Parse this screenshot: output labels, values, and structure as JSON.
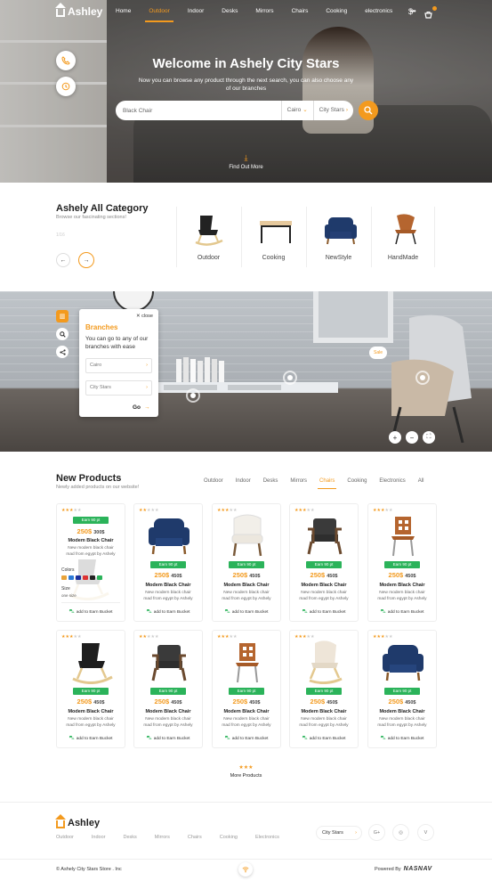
{
  "header": {
    "brand": "Ashley",
    "nav": [
      {
        "label": "Home",
        "active": false
      },
      {
        "label": "Outdoor",
        "active": true
      },
      {
        "label": "Indoor",
        "active": false
      },
      {
        "label": "Desks",
        "active": false
      },
      {
        "label": "Mirrors",
        "active": false
      },
      {
        "label": "Chairs",
        "active": false
      },
      {
        "label": "Cooking",
        "active": false
      },
      {
        "label": "electronics",
        "active": false
      }
    ],
    "more": "•••",
    "currency_icon": "$",
    "cart_icon": "cart"
  },
  "hero": {
    "title": "Welcome in Ashely City Stars",
    "subtitle": "Now you can browse any product through the next search, you can also choose any of our branches",
    "search_value": "Black Chair",
    "city": "Cairo",
    "branch": "City Stars",
    "find_more": "Find Out More"
  },
  "category": {
    "title": "Ashely All Category",
    "subtitle": "Browse our fascinating sections!",
    "count": "1/16",
    "items": [
      "Outdoor",
      "Cooking",
      "NewStyle",
      "HandMade"
    ]
  },
  "branches": {
    "close": "close",
    "title": "Branches",
    "desc": "You can go to any of our branches with ease",
    "city": "Cairo",
    "branch": "City Stars",
    "go": "Go"
  },
  "room": {
    "sale": "Sale"
  },
  "products": {
    "title": "New Products",
    "subtitle": "Newly added products on our website!",
    "filters": [
      {
        "label": "Outdoor",
        "active": false
      },
      {
        "label": "Indoor",
        "active": false
      },
      {
        "label": "Desks",
        "active": false
      },
      {
        "label": "Mirrors",
        "active": false
      },
      {
        "label": "Chairs",
        "active": true
      },
      {
        "label": "Cooking",
        "active": false
      },
      {
        "label": "Electronics",
        "active": false
      },
      {
        "label": "All",
        "active": false
      }
    ],
    "colors_label": "Colors",
    "size_label": "Size",
    "size_value": "one size",
    "swatches": [
      "#e8a33a",
      "#2c7ad6",
      "#1a2f9c",
      "#d33",
      "#222",
      "#2bb35a"
    ],
    "items": [
      {
        "earn": "Earn 90 pt",
        "price": "250$",
        "old": "300$",
        "name": "Modem Black Chair",
        "desc": "New modern black chair mad from egypt by Ashely",
        "add": "add to Earn Bucket",
        "rating": 3,
        "img": "rocking",
        "expanded": true
      },
      {
        "earn": "Earn 90 pt",
        "price": "250$",
        "old": "450$",
        "name": "Modem Black Chair",
        "desc": "New modern black chair mad from egypt by Ashely",
        "add": "add to Earn Bucket",
        "rating": 2,
        "img": "navy"
      },
      {
        "earn": "Earn 90 pt",
        "price": "250$",
        "old": "450$",
        "name": "Modem Black Chair",
        "desc": "New modern black chair mad from egypt by Ashely",
        "add": "add to Earn Bucket",
        "rating": 3,
        "img": "white"
      },
      {
        "earn": "Earn 90 pt",
        "price": "250$",
        "old": "450$",
        "name": "Modem Black Chair",
        "desc": "New modern black chair mad from egypt by Ashely",
        "add": "add to Earn Bucket",
        "rating": 3,
        "img": "dark"
      },
      {
        "earn": "Earn 90 pt",
        "price": "250$",
        "old": "450$",
        "name": "Modem Black Chair",
        "desc": "New modern black chair mad from egypt by Ashely",
        "add": "add to Earn Bucket",
        "rating": 3,
        "img": "brown"
      },
      {
        "earn": "Earn 90 pt",
        "price": "250$",
        "old": "450$",
        "name": "Modem Black Chair",
        "desc": "New modern black chair mad from egypt by Ashely",
        "add": "add to Earn Bucket",
        "rating": 3,
        "img": "rocking"
      },
      {
        "earn": "Earn 90 pt",
        "price": "250$",
        "old": "450$",
        "name": "Modem Black Chair",
        "desc": "New modern black chair mad from egypt by Ashely",
        "add": "add to Earn Bucket",
        "rating": 2,
        "img": "dark"
      },
      {
        "earn": "Earn 90 pt",
        "price": "250$",
        "old": "450$",
        "name": "Modem Black Chair",
        "desc": "New modern black chair mad from egypt by Ashely",
        "add": "add to Earn Bucket",
        "rating": 3,
        "img": "brown"
      },
      {
        "earn": "Earn 90 pt",
        "price": "250$",
        "old": "450$",
        "name": "Modem Black Chair",
        "desc": "New modern black chair mad from egypt by Ashely",
        "add": "add to Earn Bucket",
        "rating": 3,
        "img": "fur"
      },
      {
        "earn": "Earn 90 pt",
        "price": "250$",
        "old": "450$",
        "name": "Modem Black Chair",
        "desc": "New modern black chair mad from egypt by Ashely",
        "add": "add to Earn Bucket",
        "rating": 3,
        "img": "navy"
      }
    ],
    "more": "More Products"
  },
  "footer": {
    "brand": "Ashley",
    "nav": [
      "Outdoor",
      "Indoor",
      "Desks",
      "Mirrors",
      "Chairs",
      "Cooking",
      "Electronics"
    ],
    "city": "City Stars",
    "social": [
      "G+",
      "◎",
      "V"
    ],
    "copyright": "© Ashely City Stars Store . Inc",
    "powered": "Powered By",
    "powered_brand": "NASNAV"
  },
  "colors": {
    "accent": "#f39a1e",
    "green": "#2bb35a"
  }
}
